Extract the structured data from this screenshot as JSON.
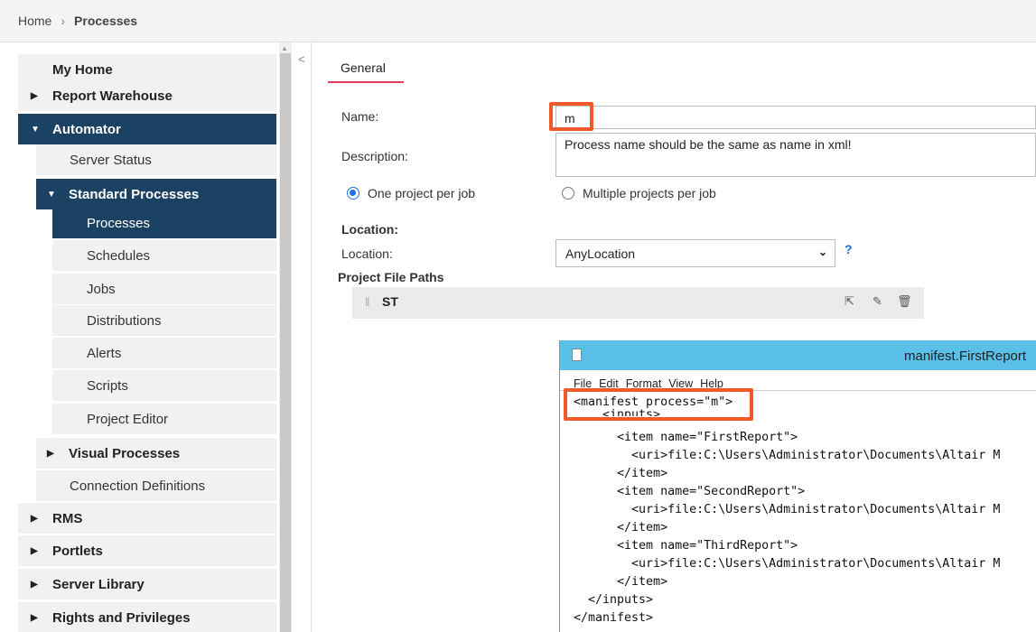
{
  "breadcrumb": {
    "home": "Home",
    "separator": "›",
    "current": "Processes"
  },
  "sidebar": {
    "my_home": "My Home",
    "report_warehouse": "Report Warehouse",
    "automator": "Automator",
    "server_status": "Server Status",
    "standard_processes": "Standard Processes",
    "processes": "Processes",
    "schedules": "Schedules",
    "jobs": "Jobs",
    "distributions": "Distributions",
    "alerts": "Alerts",
    "scripts": "Scripts",
    "project_editor": "Project Editor",
    "visual_processes": "Visual Processes",
    "connection_definitions": "Connection Definitions",
    "rms": "RMS",
    "portlets": "Portlets",
    "server_library": "Server Library",
    "rights_and_privileges": "Rights and Privileges"
  },
  "tabs": {
    "general": "General"
  },
  "form": {
    "name_label": "Name:",
    "name_value": "m",
    "description_label": "Description:",
    "description_value": "Process name should be the same as name in xml!",
    "radio_one": "One project per job",
    "radio_multiple": "Multiple projects per job",
    "radio_selected": "One project per job",
    "location_heading": "Location:",
    "location_label": "Location:",
    "location_value": "AnyLocation",
    "help": "?",
    "project_file_paths": "Project File Paths",
    "path_item": "ST"
  },
  "notepad": {
    "title": "manifest.FirstReport",
    "menu": [
      "File",
      "Edit",
      "Format",
      "View",
      "Help"
    ],
    "lines": [
      "<manifest process=\"m\">",
      "    <inputs>",
      "      <item name=\"FirstReport\">",
      "        <uri>file:C:\\Users\\Administrator\\Documents\\Altair M",
      "      </item>",
      "      <item name=\"SecondReport\">",
      "        <uri>file:C:\\Users\\Administrator\\Documents\\Altair M",
      "      </item>",
      "      <item name=\"ThirdReport\">",
      "        <uri>file:C:\\Users\\Administrator\\Documents\\Altair M",
      "      </item>",
      "  </inputs>",
      "</manifest>"
    ]
  },
  "colors": {
    "accent_nav": "#1c4263",
    "tab_underline": "#e23b5d",
    "highlight": "#f05a28",
    "notepad_title": "#5bc0e8"
  }
}
